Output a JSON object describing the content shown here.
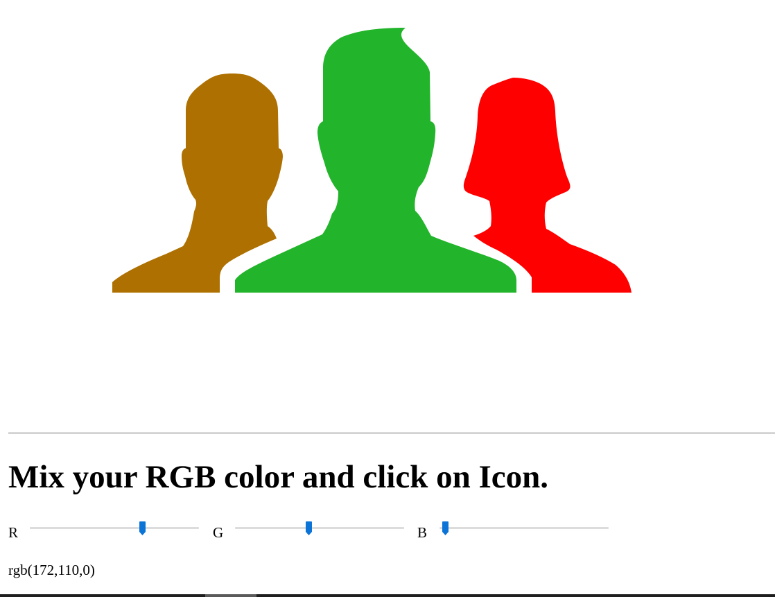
{
  "icon": {
    "people": [
      {
        "name": "left-person",
        "color": "#ae7000"
      },
      {
        "name": "center-person",
        "color": "#22b42a"
      },
      {
        "name": "right-person",
        "color": "#ff0000"
      }
    ]
  },
  "heading": "Mix your RGB color and click on Icon.",
  "controls": {
    "accent": "#0b74d6",
    "max": 255,
    "sliders": [
      {
        "label": "R",
        "value": 172
      },
      {
        "label": "G",
        "value": 110
      },
      {
        "label": "B",
        "value": 0
      }
    ]
  },
  "readout": "rgb(172,110,0)"
}
